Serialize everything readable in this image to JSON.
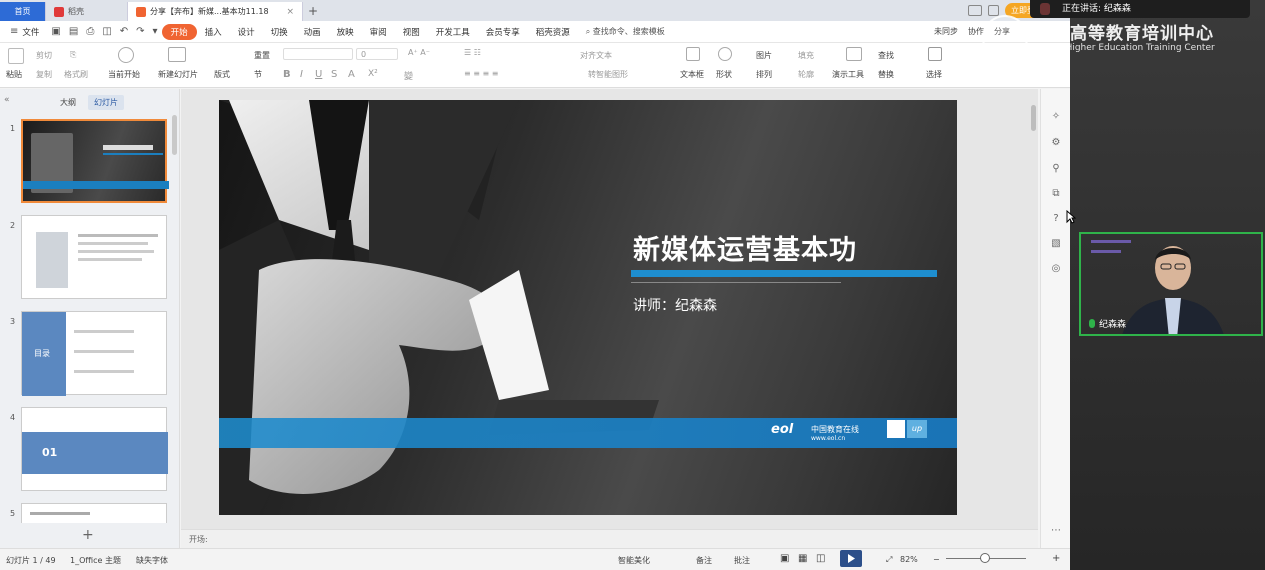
{
  "tabs": {
    "home": "首页",
    "daoke": "稻壳",
    "document": "分享【奔布】新媒...基本功11.18",
    "login": "立即登录"
  },
  "menu": {
    "file": "文件",
    "items": [
      "开始",
      "插入",
      "设计",
      "切换",
      "动画",
      "放映",
      "审阅",
      "视图",
      "开发工具",
      "会员专享",
      "稻壳资源"
    ],
    "active": "开始",
    "search": "查找命令、搜索模板",
    "right": [
      "未同步",
      "协作",
      "分享"
    ]
  },
  "ribbon": {
    "paste": "粘贴",
    "cut": "剪切",
    "copy": "复制",
    "format_painter": "格式刷",
    "from_current": "当前开始",
    "new_slide": "新建幻灯片",
    "layout": "版式",
    "section": "节",
    "reset": "重置",
    "font_size": "0",
    "align_text": "对齐文本",
    "convert_smartart": "转智能图形",
    "textbox": "文本框",
    "shape": "形状",
    "picture": "图片",
    "arrange": "排列",
    "fill": "填充",
    "outline": "轮廓",
    "present_tools": "演示工具",
    "find": "查找",
    "replace": "替换",
    "select": "选择"
  },
  "thumbs": {
    "tab_outline": "大纲",
    "tab_slides": "幻灯片",
    "active_tab": "幻灯片",
    "numbers": [
      "1",
      "2",
      "3",
      "4",
      "5"
    ],
    "slide3_text": "目录",
    "slide4_text": "01"
  },
  "slide": {
    "title": "新媒体运营基本功",
    "subtitle": "讲师：纪森森",
    "logo_eol": "中国教育在线",
    "logo_url": "www.eol.cn"
  },
  "notes": {
    "placeholder": "开场:"
  },
  "status": {
    "slide_count": "幻灯片 1 / 49",
    "theme": "1_Office 主题",
    "font_missing": "缺失字体",
    "smart_beautify": "智能美化",
    "notes": "备注",
    "comments": "批注",
    "zoom": "82%"
  },
  "meeting": {
    "speaking_label": "正在讲话: 纪森森",
    "watermark_cn": "中国高等教育培训中心",
    "watermark_en": "China Higher Education Training Center",
    "participant_name": "纪森森"
  }
}
